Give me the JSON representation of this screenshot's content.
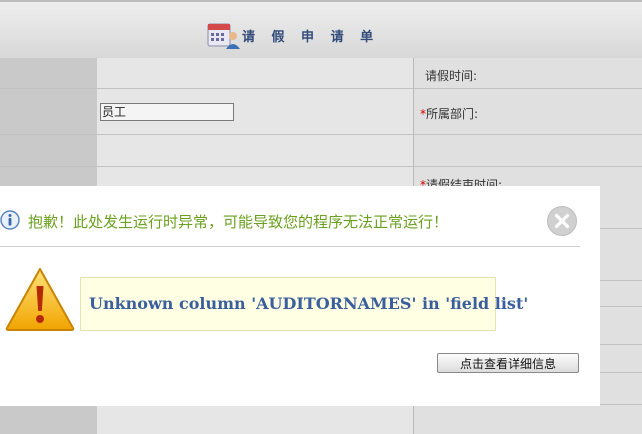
{
  "form": {
    "title": "请 假 申 请 单",
    "fields": {
      "leave_time_label": "请假时间:",
      "department_label": "所属部门:",
      "end_time_label": "请假结束时间:",
      "required_mark": "*",
      "employee_value": "员工"
    }
  },
  "dialog": {
    "title": "抱歉！此处发生运行时异常，可能导致您的程序无法正常运行！",
    "message": "Unknown column 'AUDITORNAMES' in 'field list'",
    "detail_button": "点击查看详细信息",
    "icons": {
      "info": "info-icon",
      "warning": "warning-icon",
      "close": "close-icon"
    }
  },
  "colors": {
    "dialog_title": "#6aa11e",
    "message_text": "#3a5f9c",
    "message_bg": "#ffffe4",
    "form_title": "#334c7a",
    "required": "#d20000"
  }
}
